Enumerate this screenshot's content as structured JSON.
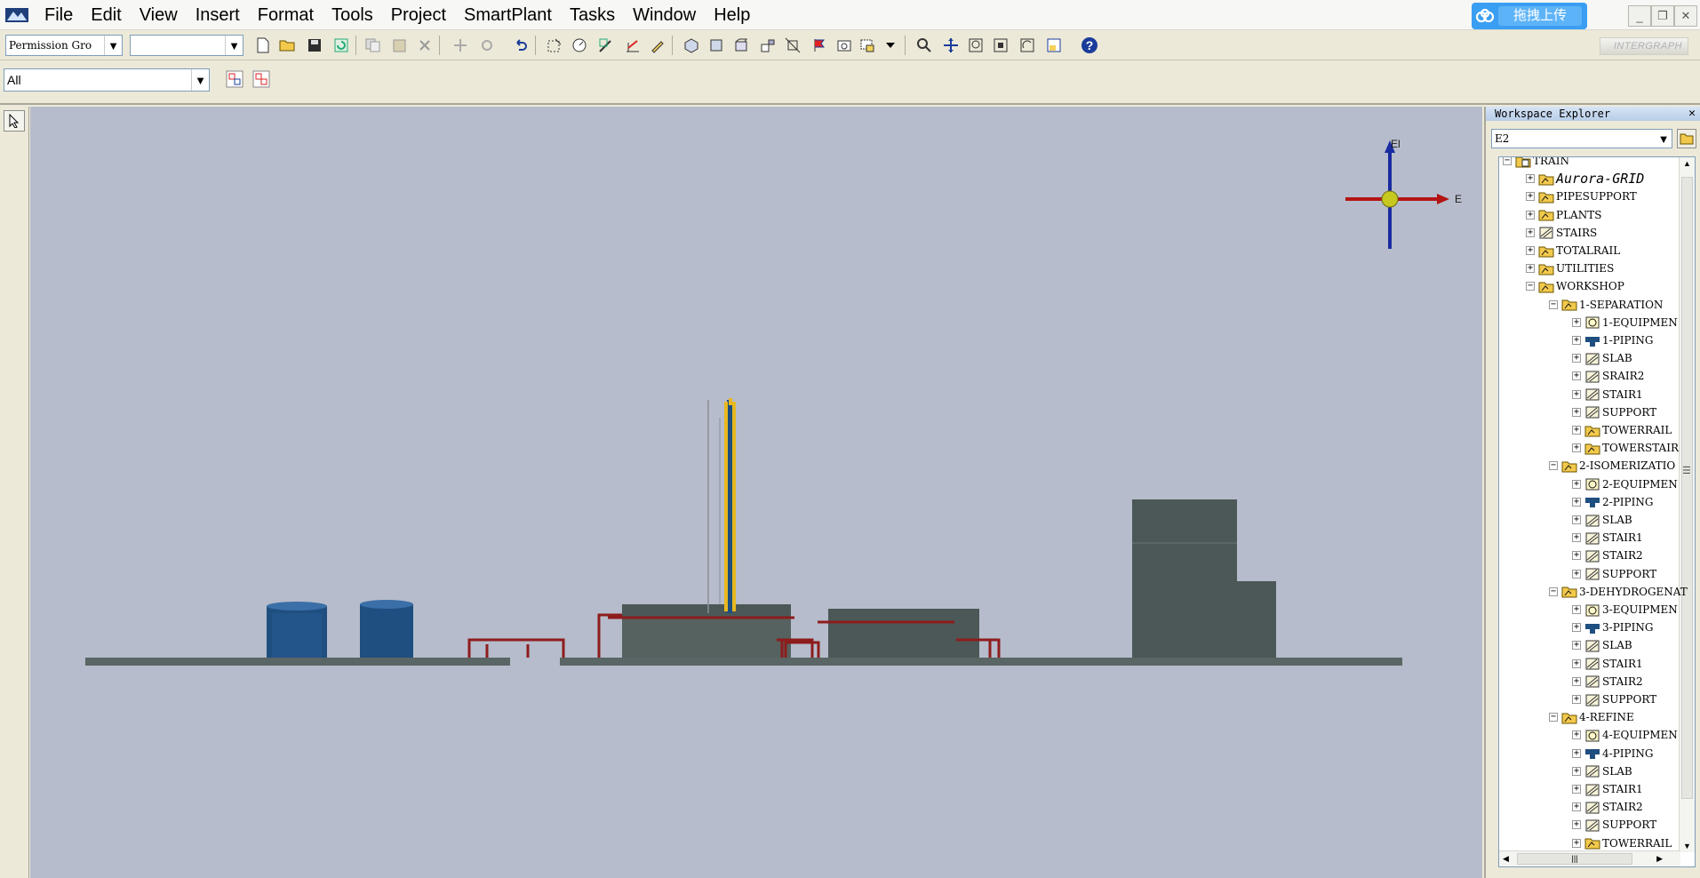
{
  "menubar": {
    "items": [
      "File",
      "Edit",
      "View",
      "Insert",
      "Format",
      "Tools",
      "Project",
      "SmartPlant",
      "Tasks",
      "Window",
      "Help"
    ],
    "upload_label": "拖拽上传"
  },
  "toolbar": {
    "permission_group": "Permission Gro",
    "second_combo": "",
    "filter_value": "All",
    "logo_text": "INTERGRAPH"
  },
  "compass": {
    "up_label": "El",
    "right_label": "E"
  },
  "workspace_explorer": {
    "title": "Workspace Explorer",
    "combo_value": "E2",
    "tree": [
      {
        "label": "TRAIN",
        "level": 0,
        "toggle": "−",
        "icon": "root-folder-icon"
      },
      {
        "label": "Aurora-GRID",
        "level": 1,
        "toggle": "+",
        "icon": "system-folder-icon",
        "italic": true
      },
      {
        "label": "PIPESUPPORT",
        "level": 1,
        "toggle": "+",
        "icon": "system-folder-icon"
      },
      {
        "label": "PLANTS",
        "level": 1,
        "toggle": "+",
        "icon": "system-folder-icon"
      },
      {
        "label": "STAIRS",
        "level": 1,
        "toggle": "+",
        "icon": "structure-icon"
      },
      {
        "label": "TOTALRAIL",
        "level": 1,
        "toggle": "+",
        "icon": "system-folder-icon"
      },
      {
        "label": "UTILITIES",
        "level": 1,
        "toggle": "+",
        "icon": "system-folder-icon"
      },
      {
        "label": "WORKSHOP",
        "level": 1,
        "toggle": "−",
        "icon": "system-folder-icon"
      },
      {
        "label": "1-SEPARATION",
        "level": 2,
        "toggle": "−",
        "icon": "system-folder-icon"
      },
      {
        "label": "1-EQUIPMEN",
        "level": 3,
        "toggle": "+",
        "icon": "equipment-icon"
      },
      {
        "label": "1-PIPING",
        "level": 3,
        "toggle": "+",
        "icon": "piping-icon"
      },
      {
        "label": "SLAB",
        "level": 3,
        "toggle": "+",
        "icon": "structure-icon"
      },
      {
        "label": "SRAIR2",
        "level": 3,
        "toggle": "+",
        "icon": "structure-icon"
      },
      {
        "label": "STAIR1",
        "level": 3,
        "toggle": "+",
        "icon": "structure-icon"
      },
      {
        "label": "SUPPORT",
        "level": 3,
        "toggle": "+",
        "icon": "structure-icon"
      },
      {
        "label": "TOWERRAIL",
        "level": 3,
        "toggle": "+",
        "icon": "system-folder-icon"
      },
      {
        "label": "TOWERSTAIR",
        "level": 3,
        "toggle": "+",
        "icon": "system-folder-icon"
      },
      {
        "label": "2-ISOMERIZATIO",
        "level": 2,
        "toggle": "−",
        "icon": "system-folder-icon"
      },
      {
        "label": "2-EQUIPMEN",
        "level": 3,
        "toggle": "+",
        "icon": "equipment-icon"
      },
      {
        "label": "2-PIPING",
        "level": 3,
        "toggle": "+",
        "icon": "piping-icon"
      },
      {
        "label": "SLAB",
        "level": 3,
        "toggle": "+",
        "icon": "structure-icon"
      },
      {
        "label": "STAIR1",
        "level": 3,
        "toggle": "+",
        "icon": "structure-icon"
      },
      {
        "label": "STAIR2",
        "level": 3,
        "toggle": "+",
        "icon": "structure-icon"
      },
      {
        "label": "SUPPORT",
        "level": 3,
        "toggle": "+",
        "icon": "structure-icon"
      },
      {
        "label": "3-DEHYDROGENAT",
        "level": 2,
        "toggle": "−",
        "icon": "system-folder-icon"
      },
      {
        "label": "3-EQUIPMEN",
        "level": 3,
        "toggle": "+",
        "icon": "equipment-icon"
      },
      {
        "label": "3-PIPING",
        "level": 3,
        "toggle": "+",
        "icon": "piping-icon"
      },
      {
        "label": "SLAB",
        "level": 3,
        "toggle": "+",
        "icon": "structure-icon"
      },
      {
        "label": "STAIR1",
        "level": 3,
        "toggle": "+",
        "icon": "structure-icon"
      },
      {
        "label": "STAIR2",
        "level": 3,
        "toggle": "+",
        "icon": "structure-icon"
      },
      {
        "label": "SUPPORT",
        "level": 3,
        "toggle": "+",
        "icon": "structure-icon"
      },
      {
        "label": "4-REFINE",
        "level": 2,
        "toggle": "−",
        "icon": "system-folder-icon"
      },
      {
        "label": "4-EQUIPMEN",
        "level": 3,
        "toggle": "+",
        "icon": "equipment-icon"
      },
      {
        "label": "4-PIPING",
        "level": 3,
        "toggle": "+",
        "icon": "piping-icon"
      },
      {
        "label": "SLAB",
        "level": 3,
        "toggle": "+",
        "icon": "structure-icon"
      },
      {
        "label": "STAIR1",
        "level": 3,
        "toggle": "+",
        "icon": "structure-icon"
      },
      {
        "label": "STAIR2",
        "level": 3,
        "toggle": "+",
        "icon": "structure-icon"
      },
      {
        "label": "SUPPORT",
        "level": 3,
        "toggle": "+",
        "icon": "structure-icon"
      },
      {
        "label": "TOWERRAIL",
        "level": 3,
        "toggle": "+",
        "icon": "system-folder-icon"
      }
    ]
  },
  "colors": {
    "viewport_bg": "#b6bccb",
    "ground": "#5a6665",
    "tank": "#1f4e80",
    "pipe_red": "#8e1c1c",
    "tower_yellow": "#e8b820",
    "building": "#4b5857"
  }
}
